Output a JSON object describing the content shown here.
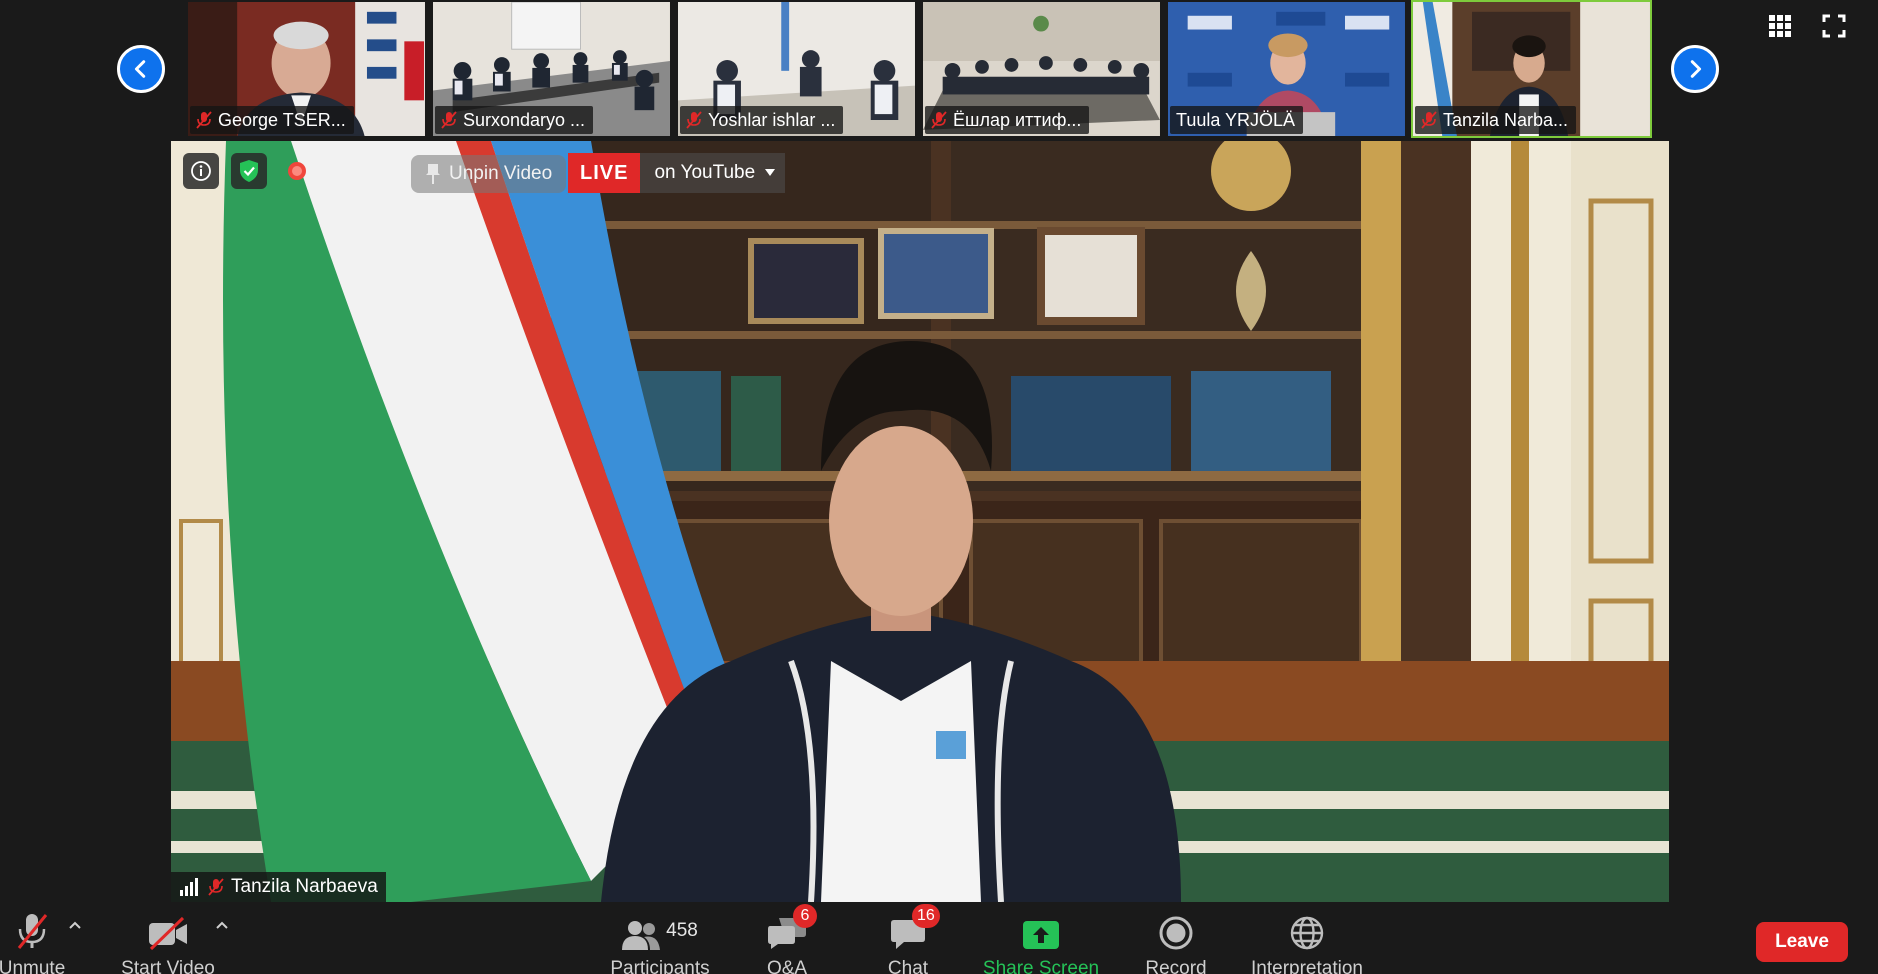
{
  "thumbnails": [
    {
      "name": "George TSER..."
    },
    {
      "name": "Surxondaryo ..."
    },
    {
      "name": "Yoshlar ishlar ..."
    },
    {
      "name": "Ёшлар иттиф..."
    },
    {
      "name": "Tuula YRJÖLÄ"
    },
    {
      "name": "Tanzila Narba..."
    }
  ],
  "main": {
    "speaker_name": "Tanzila Narbaeva",
    "unpin_label": "Unpin Video",
    "live_label": "LIVE",
    "live_platform": "on YouTube"
  },
  "toolbar": {
    "unmute_label": "Unmute",
    "start_video_label": "Start Video",
    "participants_label": "Participants",
    "participants_count": "458",
    "qa_label": "Q&A",
    "qa_badge": "6",
    "chat_label": "Chat",
    "chat_badge": "16",
    "share_label": "Share Screen",
    "record_label": "Record",
    "interpretation_label": "Interpretation",
    "leave_label": "Leave"
  },
  "colors": {
    "accent_blue": "#0e72ed",
    "live_red": "#e02828",
    "share_green": "#25c257",
    "active_speaker_border": "#7ecb3c"
  }
}
